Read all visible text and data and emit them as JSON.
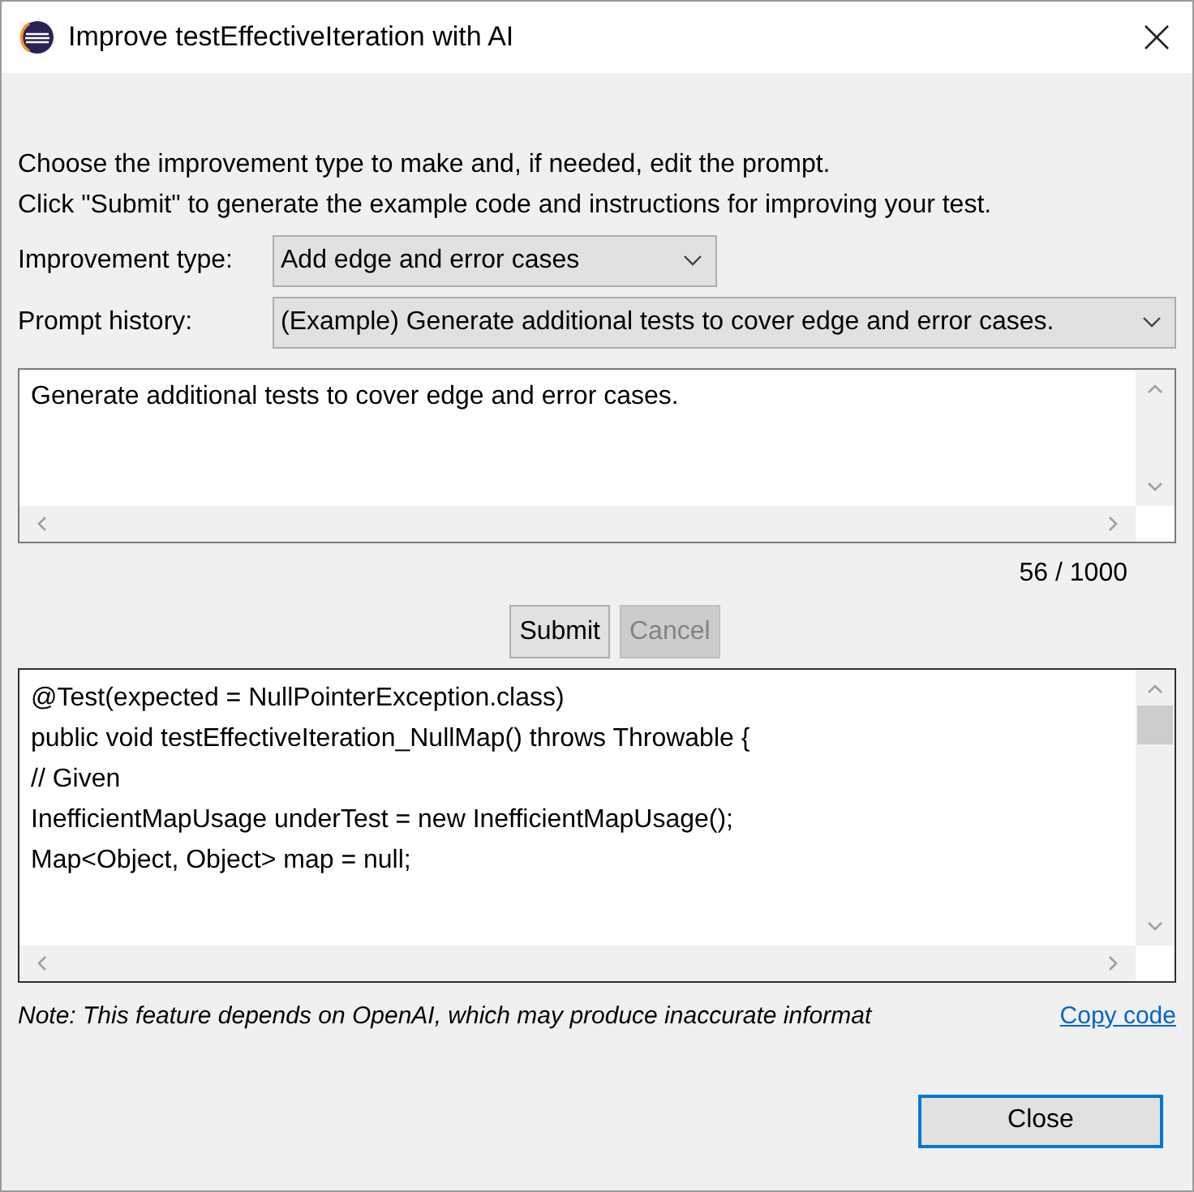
{
  "window": {
    "title": "Improve testEffectiveIteration with AI"
  },
  "instructions": [
    "Choose the improvement type to make and, if needed, edit the prompt.",
    "Click \"Submit\" to generate the example code and instructions for improving your test."
  ],
  "improvement_type": {
    "label": "Improvement type:",
    "value": "Add edge and error cases"
  },
  "prompt_history": {
    "label": "Prompt history:",
    "value": "(Example) Generate additional tests to cover edge and error cases."
  },
  "prompt": {
    "value": "Generate additional tests to cover edge and error cases."
  },
  "counter": "56 / 1000",
  "buttons": [
    {
      "label": "Submit",
      "disabled": false
    },
    {
      "label": "Cancel",
      "disabled": true
    }
  ],
  "code": {
    "lines": [
      "@Test(expected = NullPointerException.class)",
      "public void testEffectiveIteration_NullMap() throws Throwable {",
      "// Given",
      "InefficientMapUsage underTest = new InefficientMapUsage();",
      "Map<Object, Object> map = null;"
    ]
  },
  "note": "Note: This feature depends on OpenAI, which may produce inaccurate informat",
  "copy_link": "Copy code",
  "close_button": {
    "label": "Close",
    "default": true
  }
}
